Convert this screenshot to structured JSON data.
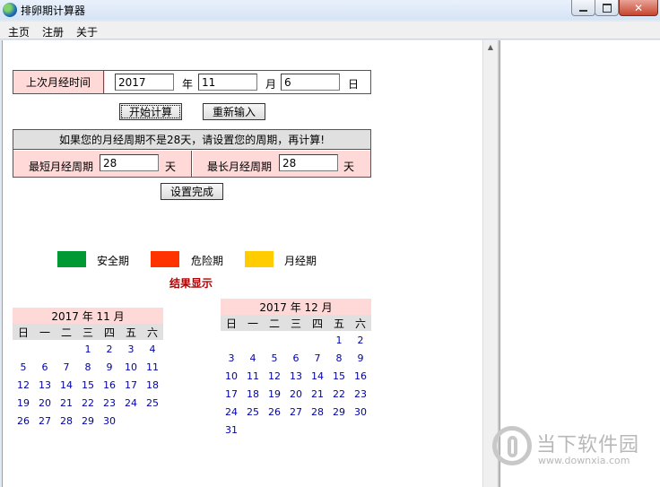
{
  "window": {
    "title": "排卵期计算器",
    "close_glyph": "✕"
  },
  "menu": [
    "主页",
    "注册",
    "关于"
  ],
  "form": {
    "last_period_label": "上次月经时间",
    "year": "2017",
    "year_unit": "年",
    "month": "11",
    "month_unit": "月",
    "day": "6",
    "day_unit": "日",
    "calc_button": "开始计算",
    "reset_button": "重新输入",
    "cycle_notice": "如果您的月经周期不是28天，请设置您的周期，再计算!",
    "min_cycle_label": "最短月经周期",
    "min_cycle_value": "28",
    "max_cycle_label": "最长月经周期",
    "max_cycle_value": "28",
    "day_unit2": "天",
    "set_button": "设置完成"
  },
  "legend": [
    {
      "label": "安全期",
      "color": "#009933"
    },
    {
      "label": "危险期",
      "color": "#ff3300"
    },
    {
      "label": "月经期",
      "color": "#ffcc00"
    }
  ],
  "result_title": "结果显示",
  "weekdays": [
    "日",
    "一",
    "二",
    "三",
    "四",
    "五",
    "六"
  ],
  "calendars": [
    {
      "title": "2017  年  11  月",
      "rows": [
        [
          "",
          "",
          "",
          "1",
          "2",
          "3",
          "4"
        ],
        [
          "5",
          "6",
          "7",
          "8",
          "9",
          "10",
          "11"
        ],
        [
          "12",
          "13",
          "14",
          "15",
          "16",
          "17",
          "18"
        ],
        [
          "19",
          "20",
          "21",
          "22",
          "23",
          "24",
          "25"
        ],
        [
          "26",
          "27",
          "28",
          "29",
          "30",
          "",
          ""
        ]
      ]
    },
    {
      "title": "2017  年  12  月",
      "rows": [
        [
          "",
          "",
          "",
          "",
          "",
          "1",
          "2"
        ],
        [
          "3",
          "4",
          "5",
          "6",
          "7",
          "8",
          "9"
        ],
        [
          "10",
          "11",
          "12",
          "13",
          "14",
          "15",
          "16"
        ],
        [
          "17",
          "18",
          "19",
          "20",
          "21",
          "22",
          "23"
        ],
        [
          "24",
          "25",
          "26",
          "27",
          "28",
          "29",
          "30"
        ],
        [
          "31",
          "",
          "",
          "",
          "",
          "",
          ""
        ]
      ]
    }
  ],
  "watermark": {
    "name": "当下软件园",
    "url": "www.downxia.com"
  }
}
